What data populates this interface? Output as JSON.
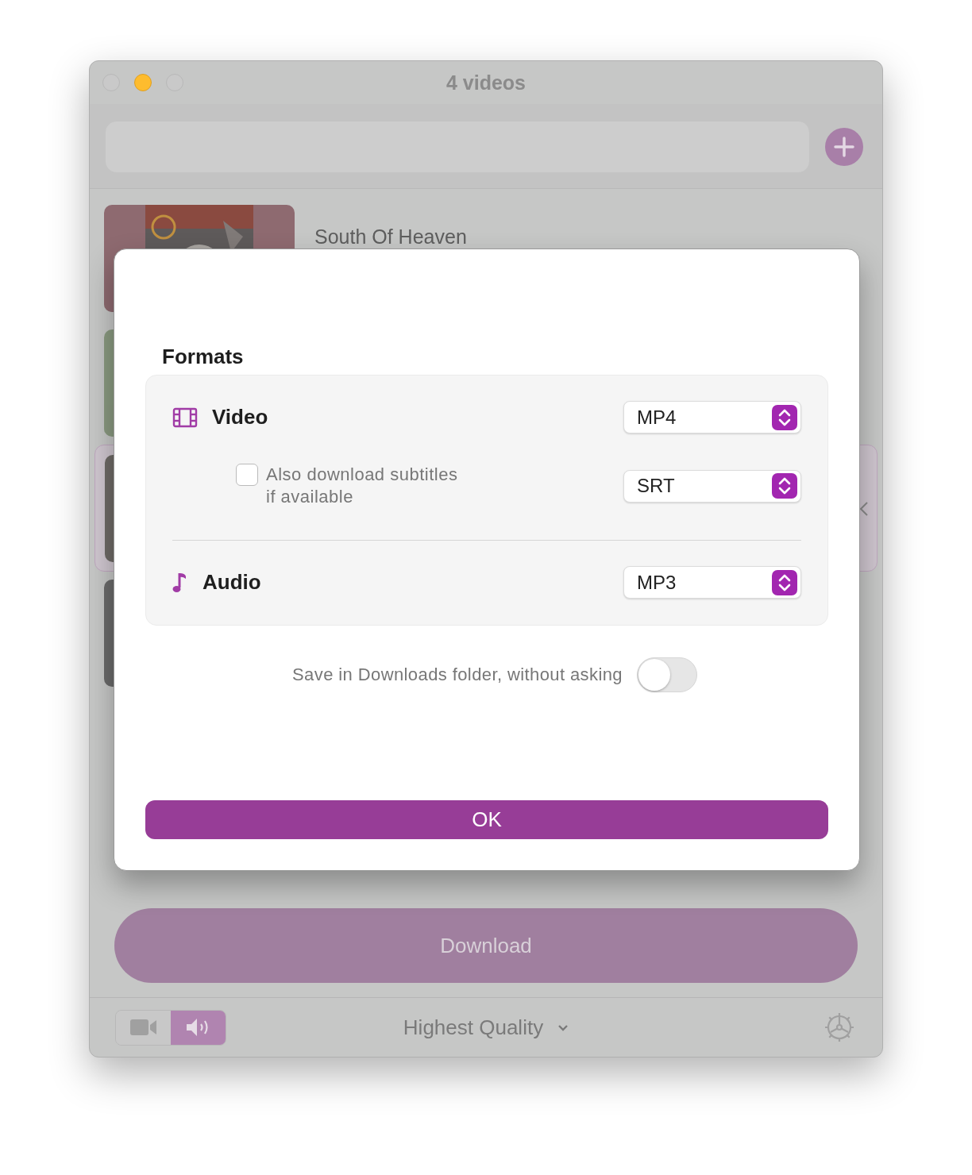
{
  "window": {
    "title": "4 videos"
  },
  "videos": [
    {
      "title": "South Of Heaven",
      "selected": false
    },
    {
      "selected": false
    },
    {
      "selected": true
    },
    {
      "selected": false
    }
  ],
  "dialog": {
    "heading": "Formats",
    "formats": [
      {
        "kind": "video",
        "label": "Video",
        "value": "MP4"
      },
      {
        "kind": "subtitles",
        "label": "Also download subtitles\nif available",
        "checked": false,
        "value": "SRT"
      },
      {
        "kind": "audio",
        "label": "Audio",
        "value": "MP3"
      }
    ],
    "save_toggle": {
      "label": "Save in Downloads folder, without asking",
      "on": false
    },
    "ok_button": "OK"
  },
  "download_button": "Download",
  "mode_switch": [
    {
      "kind": "video",
      "selected": false
    },
    {
      "kind": "audio",
      "selected": true
    }
  ],
  "quality": "Highest Quality"
}
